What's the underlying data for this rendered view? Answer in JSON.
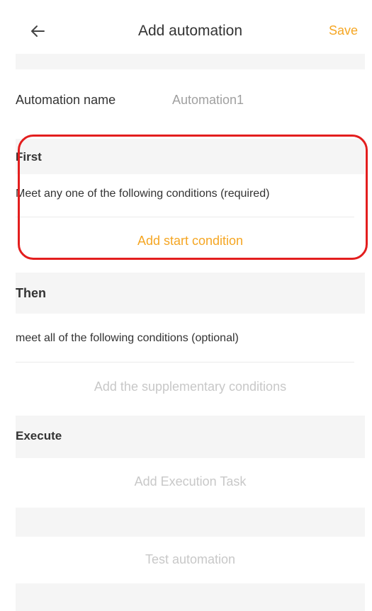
{
  "header": {
    "title": "Add automation",
    "save_label": "Save"
  },
  "automation_name": {
    "label": "Automation name",
    "value": "Automation1"
  },
  "first": {
    "title": "First",
    "condition_text": "Meet any one of the following conditions (required)",
    "add_label": "Add start condition"
  },
  "then": {
    "title": "Then",
    "condition_text": "meet all of the following conditions (optional)",
    "add_label": "Add the supplementary conditions"
  },
  "execute": {
    "title": "Execute",
    "add_label": "Add Execution Task"
  },
  "test": {
    "label": "Test automation"
  },
  "colors": {
    "accent": "#f5a623",
    "highlight": "#e31e1e",
    "disabled_text": "#c8c8c8",
    "section_bg": "#f5f5f5"
  },
  "icons": {
    "back": "arrow-left-icon"
  }
}
